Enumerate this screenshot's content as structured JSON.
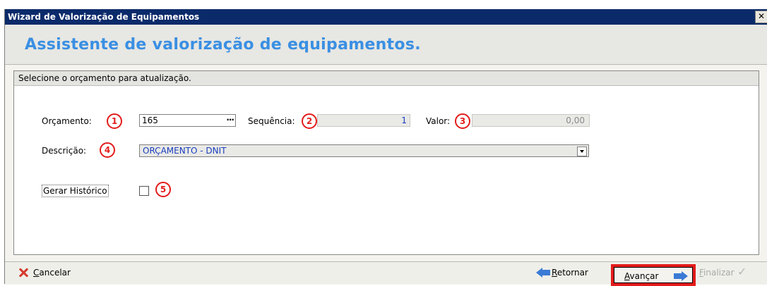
{
  "window": {
    "title": "Wizard de Valorização de Equipamentos",
    "close_glyph": "✕"
  },
  "header": {
    "title": "Assistente de valorização de equipamentos."
  },
  "panel": {
    "instruction": "Selecione o orçamento para atualização."
  },
  "form": {
    "orcamento": {
      "label": "Orçamento:",
      "value": "165",
      "lookup_glyph": "···",
      "badge": "1"
    },
    "sequencia": {
      "label": "Sequência:",
      "value": "1",
      "badge": "2"
    },
    "valor": {
      "label": "Valor:",
      "value": "0,00",
      "badge": "3"
    },
    "descricao": {
      "label": "Descrição:",
      "value": "ORÇAMENTO - DNIT",
      "badge": "4"
    },
    "gerar_historico": {
      "label": "Gerar Histórico",
      "checked": false,
      "badge": "5"
    }
  },
  "footer": {
    "cancelar": {
      "label": "Cancelar",
      "accel": "C",
      "rest": "ancelar",
      "icon": "x-icon"
    },
    "retornar": {
      "label": "Retornar",
      "accel": "R",
      "rest": "etornar",
      "icon": "arrow-left-icon"
    },
    "avancar": {
      "label": "Avançar",
      "accel": "A",
      "rest": "vançar",
      "icon": "arrow-right-icon"
    },
    "finalizar": {
      "label": "Finalizar",
      "accel": "F",
      "rest": "inalizar",
      "icon": "check-icon",
      "enabled": false
    }
  },
  "colors": {
    "title_bar": "#0b2a6a",
    "header_title": "#3a8fe3",
    "annotation_red": "#e31b1b",
    "description_text": "#1a3fbf"
  }
}
